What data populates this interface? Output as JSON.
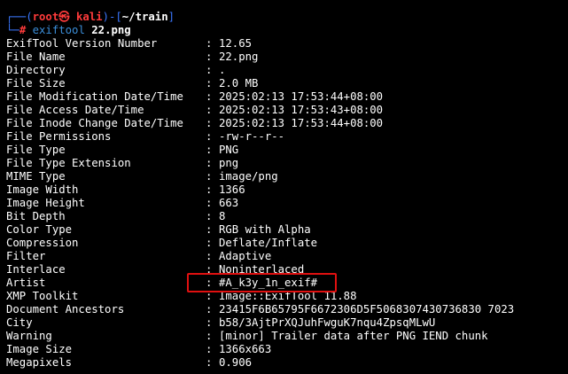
{
  "prompt": {
    "line1_prefix": "┌──(",
    "user_host": "root㉿ kali",
    "line1_mid": ")-[",
    "path": "~/train",
    "line1_suffix": "]",
    "line2_prefix": "└─",
    "hash": "#",
    "command": "exiftool",
    "argument": "22.png"
  },
  "rows": [
    {
      "key": "ExifTool Version Number",
      "value": "12.65"
    },
    {
      "key": "File Name",
      "value": "22.png"
    },
    {
      "key": "Directory",
      "value": "."
    },
    {
      "key": "File Size",
      "value": "2.0 MB"
    },
    {
      "key": "File Modification Date/Time",
      "value": "2025:02:13 17:53:44+08:00"
    },
    {
      "key": "File Access Date/Time",
      "value": "2025:02:13 17:53:43+08:00"
    },
    {
      "key": "File Inode Change Date/Time",
      "value": "2025:02:13 17:53:44+08:00"
    },
    {
      "key": "File Permissions",
      "value": "-rw-r--r--"
    },
    {
      "key": "File Type",
      "value": "PNG"
    },
    {
      "key": "File Type Extension",
      "value": "png"
    },
    {
      "key": "MIME Type",
      "value": "image/png"
    },
    {
      "key": "Image Width",
      "value": "1366"
    },
    {
      "key": "Image Height",
      "value": "663"
    },
    {
      "key": "Bit Depth",
      "value": "8"
    },
    {
      "key": "Color Type",
      "value": "RGB with Alpha"
    },
    {
      "key": "Compression",
      "value": "Deflate/Inflate"
    },
    {
      "key": "Filter",
      "value": "Adaptive"
    },
    {
      "key": "Interlace",
      "value": "Noninterlaced"
    },
    {
      "key": "Artist",
      "value": "#A_k3y_1n_exif#"
    },
    {
      "key": "XMP Toolkit",
      "value": "Image::ExifTool 11.88"
    },
    {
      "key": "Document Ancestors",
      "value": "23415F6B65795F6672306D5F5068307430736830 7023"
    },
    {
      "key": "City",
      "value": "b58/3AjtPrXQJuhFwguK7nqu4ZpsqMLwU"
    },
    {
      "key": "Warning",
      "value": "[minor] Trailer data after PNG IEND chunk"
    },
    {
      "key": "Image Size",
      "value": "1366x663"
    },
    {
      "key": "Megapixels",
      "value": "0.906"
    }
  ],
  "separator": ":",
  "colors": {
    "background": "#000000",
    "prompt_blue": "#3b78ff",
    "prompt_red": "#ff3b3b",
    "command_blue": "#3b8ed9",
    "highlight_red": "#e01010"
  }
}
